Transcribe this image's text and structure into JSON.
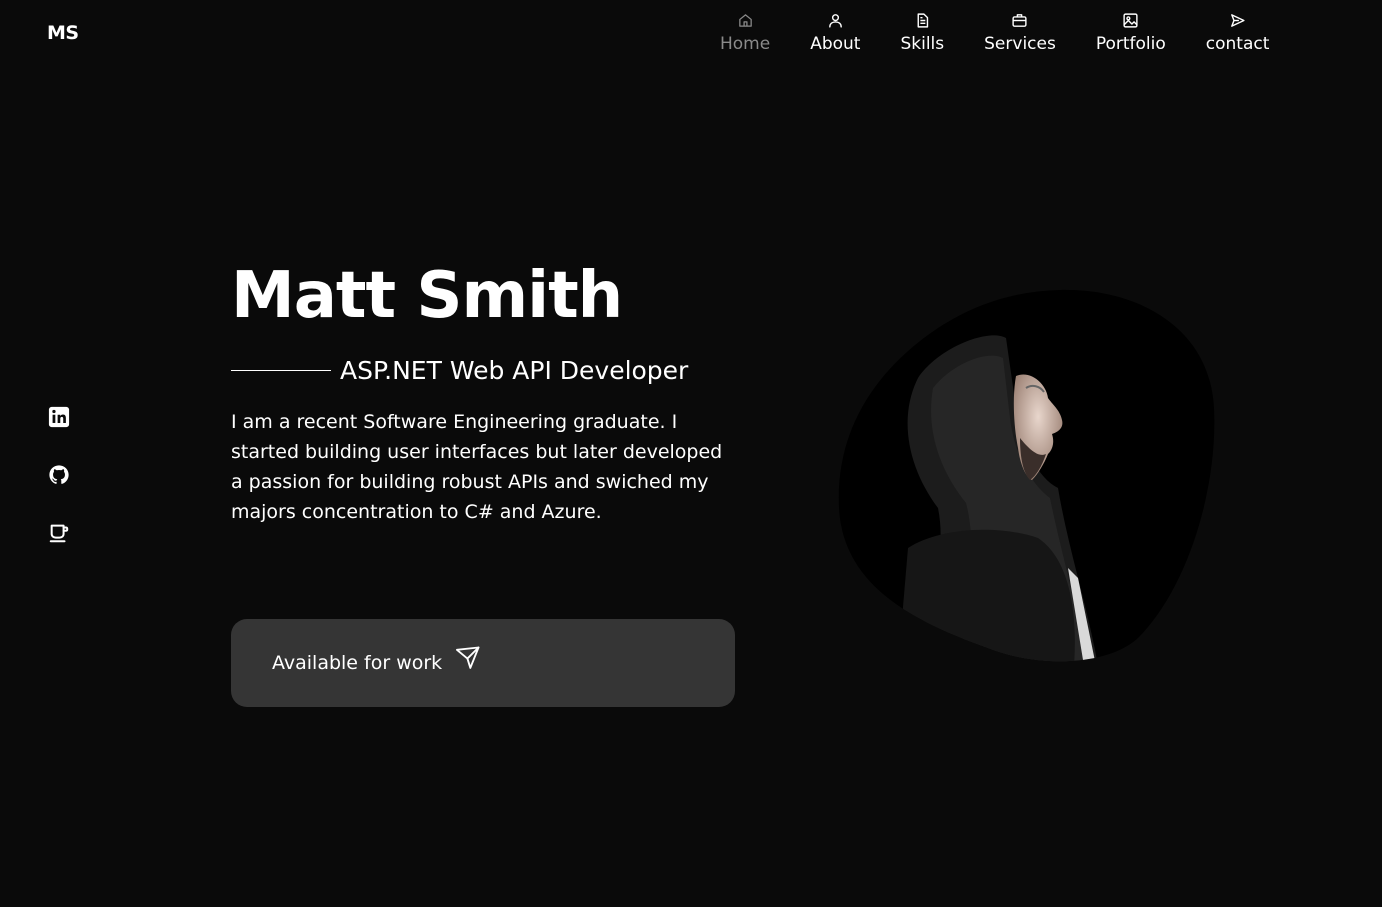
{
  "header": {
    "logo": "MS",
    "nav": [
      {
        "label": "Home",
        "icon": "home-icon",
        "active": true
      },
      {
        "label": "About",
        "icon": "user-icon",
        "active": false
      },
      {
        "label": "Skills",
        "icon": "document-icon",
        "active": false
      },
      {
        "label": "Services",
        "icon": "briefcase-icon",
        "active": false
      },
      {
        "label": "Portfolio",
        "icon": "image-icon",
        "active": false
      },
      {
        "label": "contact",
        "icon": "send-icon",
        "active": false
      }
    ]
  },
  "socials": [
    {
      "icon": "linkedin-icon"
    },
    {
      "icon": "github-icon"
    },
    {
      "icon": "coffee-cup-icon"
    }
  ],
  "hero": {
    "name": "Matt Smith",
    "subtitle": "ASP.NET Web API Developer",
    "bio": "I am a recent Software Engineering graduate. I started building user interfaces but later developed a passion for building robust APIs and swiched my majors concentration to C# and Azure.",
    "cta_label": "Available for work",
    "cta_icon": "send-icon"
  },
  "colors": {
    "background": "#0a0a0a",
    "text": "#ffffff",
    "nav_active": "#8a8a8a",
    "cta_background": "#353535"
  }
}
